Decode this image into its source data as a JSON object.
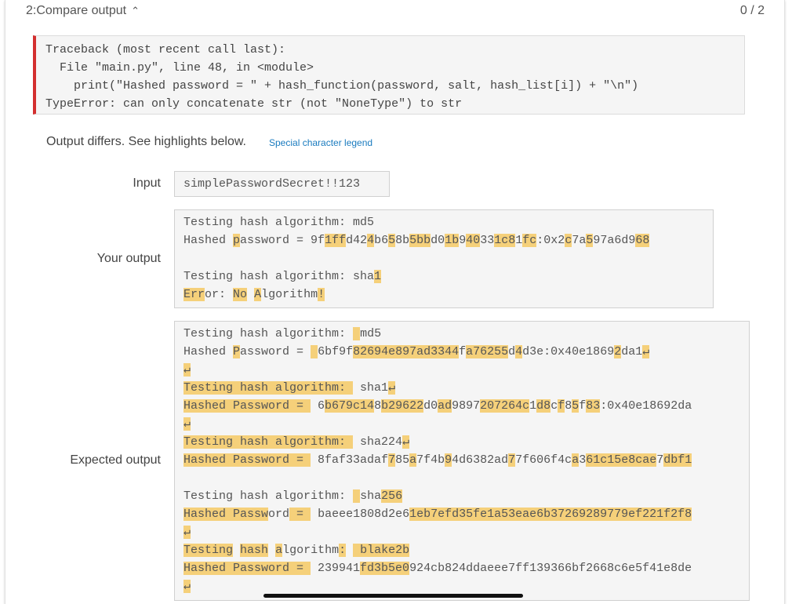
{
  "header": {
    "title": "2:Compare output",
    "chevron": "chevron-up-icon",
    "score": "0 / 2"
  },
  "traceback": {
    "lines": [
      "Traceback (most recent call last):",
      "  File \"main.py\", line 48, in <module>",
      "    print(\"Hashed password = \" + hash_function(password, salt, hash_list[i]) + \"\\n\")",
      "TypeError: can only concatenate str (not \"NoneType\") to str"
    ]
  },
  "diff": {
    "message": "Output differs. See highlights below.",
    "legend_link": "Special character legend"
  },
  "input": {
    "label": "Input",
    "value": "simplePasswordSecret!!123"
  },
  "your_output": {
    "label": "Your output",
    "lines": [
      [
        [
          "Testing hash algorithm: md5",
          0
        ]
      ],
      [
        [
          "Hashed ",
          0
        ],
        [
          "p",
          1
        ],
        [
          "assword = 9f",
          0
        ],
        [
          "1ff",
          1
        ],
        [
          "d42",
          0
        ],
        [
          "4",
          1
        ],
        [
          "b6",
          0
        ],
        [
          "5",
          1
        ],
        [
          "8b",
          0
        ],
        [
          "5bb",
          1
        ],
        [
          "d0",
          0
        ],
        [
          "1b",
          1
        ],
        [
          "9",
          0
        ],
        [
          "40",
          1
        ],
        [
          "33",
          0
        ],
        [
          "1c8",
          1
        ],
        [
          "1",
          0
        ],
        [
          "fc",
          1
        ],
        [
          ":0x2",
          0
        ],
        [
          "c",
          1
        ],
        [
          "7a",
          0
        ],
        [
          "5",
          1
        ],
        [
          "97a6d9",
          0
        ],
        [
          "68",
          1
        ]
      ],
      [],
      [
        [
          "Testing hash algorithm: sha",
          0
        ],
        [
          "1",
          1
        ]
      ],
      [
        [
          "Err",
          1
        ],
        [
          "or: ",
          0
        ],
        [
          "No",
          1
        ],
        [
          " ",
          0
        ],
        [
          "A",
          1
        ],
        [
          "lgorithm",
          0
        ],
        [
          "!",
          1
        ]
      ]
    ]
  },
  "expected_output": {
    "label": "Expected output",
    "newline_symbol": "↵",
    "lines": [
      [
        [
          "Testing hash algorithm: ",
          0
        ],
        [
          " ",
          1
        ],
        [
          "md5",
          0
        ]
      ],
      [
        [
          "Hashed ",
          0
        ],
        [
          "P",
          1
        ],
        [
          "assword = ",
          0
        ],
        [
          " ",
          1
        ],
        [
          "6bf9f",
          0
        ],
        [
          "82694e897ad3344",
          1
        ],
        [
          "f",
          0
        ],
        [
          "a76255",
          1
        ],
        [
          "d",
          0
        ],
        [
          "4",
          1
        ],
        [
          "d3e:0x40e1869",
          0
        ],
        [
          "2",
          1
        ],
        [
          "da1",
          0
        ],
        [
          "↵",
          2
        ]
      ],
      [
        [
          "↵",
          2
        ]
      ],
      [
        [
          "Testing hash algorithm: ",
          1
        ],
        [
          " sha1",
          0
        ],
        [
          "↵",
          2
        ]
      ],
      [
        [
          "Hashed Password = ",
          1
        ],
        [
          " 6",
          0
        ],
        [
          "b679c14",
          1
        ],
        [
          "8",
          0
        ],
        [
          "b29622",
          1
        ],
        [
          "d0",
          0
        ],
        [
          "ad",
          1
        ],
        [
          "9897",
          0
        ],
        [
          "207264c",
          1
        ],
        [
          "1",
          0
        ],
        [
          "d8",
          1
        ],
        [
          "c",
          0
        ],
        [
          "f",
          1
        ],
        [
          "8",
          0
        ],
        [
          "5",
          1
        ],
        [
          "f",
          0
        ],
        [
          "83",
          1
        ],
        [
          ":0x40e18692da",
          0
        ]
      ],
      [
        [
          "↵",
          2
        ]
      ],
      [
        [
          "Testing hash algorithm: ",
          1
        ],
        [
          " sha224",
          0
        ],
        [
          "↵",
          2
        ]
      ],
      [
        [
          "Hashed Password = ",
          1
        ],
        [
          " 8faf33adaf",
          0
        ],
        [
          "7",
          1
        ],
        [
          "85",
          0
        ],
        [
          "a",
          1
        ],
        [
          "7f4b",
          0
        ],
        [
          "9",
          1
        ],
        [
          "4d6382ad",
          0
        ],
        [
          "7",
          1
        ],
        [
          "7f606f4c",
          0
        ],
        [
          "a",
          1
        ],
        [
          "3",
          0
        ],
        [
          "61c15e8cae",
          1
        ],
        [
          "7",
          0
        ],
        [
          "dbf1",
          1
        ]
      ],
      [],
      [
        [
          "Testing hash algorithm: ",
          0
        ],
        [
          " ",
          1
        ],
        [
          "sha",
          0
        ],
        [
          "256",
          1
        ]
      ],
      [
        [
          "Hashed Passw",
          1
        ],
        [
          "ord",
          0
        ],
        [
          " = ",
          1
        ],
        [
          " baeee1808d2e6",
          0
        ],
        [
          "1eb7efd35fe1a53eae6b37269289779ef221f2f8",
          1
        ]
      ],
      [
        [
          "↵",
          2
        ]
      ],
      [
        [
          "Testing",
          1
        ],
        [
          " ",
          0
        ],
        [
          "hash",
          1
        ],
        [
          " ",
          0
        ],
        [
          "a",
          1
        ],
        [
          "lgorithm",
          0
        ],
        [
          ":",
          1
        ],
        [
          " ",
          0
        ],
        [
          " blake2b",
          1
        ]
      ],
      [
        [
          "Hashed Password = ",
          1
        ],
        [
          " 239941",
          0
        ],
        [
          "fd3b5e0",
          1
        ],
        [
          "924cb824ddaeee7ff139366bf2668c6e5f41e8de",
          0
        ]
      ],
      [
        [
          "↵",
          2
        ]
      ]
    ]
  }
}
